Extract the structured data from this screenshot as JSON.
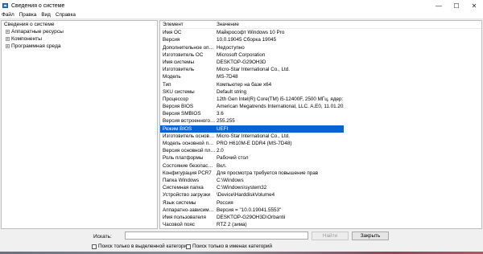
{
  "window": {
    "title": "Сведения о системе",
    "controls": [
      "—",
      "☐",
      "✕"
    ]
  },
  "menu": [
    "Файл",
    "Правка",
    "Вид",
    "Справка"
  ],
  "tree": {
    "root": "Сведения о системе",
    "children": [
      "Аппаратные ресурсы",
      "Компоненты",
      "Программная среда"
    ]
  },
  "table": {
    "headers": [
      "Элемент",
      "Значение"
    ],
    "rows": [
      [
        "Имя ОС",
        "Майкрософт Windows 10 Pro"
      ],
      [
        "Версия",
        "10.0.19045 Сборка 19045"
      ],
      [
        "Дополнительное опис...",
        "Недоступно"
      ],
      [
        "Изготовитель ОС",
        "Microsoft Corporation"
      ],
      [
        "Имя системы",
        "DESKTOP-G29OH3D"
      ],
      [
        "Изготовитель",
        "Micro-Star International Co., Ltd."
      ],
      [
        "Модель",
        "MS-7D48"
      ],
      [
        "Тип",
        "Компьютер на базе x64"
      ],
      [
        "SKU системы",
        "Default string"
      ],
      [
        "Процессор",
        "12th Gen Intel(R) Core(TM) i5-12400F, 2500 МГц, ядер: 6, л..."
      ],
      [
        "Версия BIOS",
        "American Megatrends International, LLC. A.E0, 11.01.2024"
      ],
      [
        "Версия SMBIOS",
        "3.6"
      ],
      [
        "Версия встроенного к...",
        "255.255"
      ],
      [
        "Режим BIOS",
        "UEFI"
      ],
      [
        "Изготовитель основно...",
        "Micro-Star International Co., Ltd."
      ],
      [
        "Модель основной плат...",
        "PRO H610M-E DDR4 (MS-7D48)"
      ],
      [
        "Версия основной плат...",
        "2.0"
      ],
      [
        "Роль платформы",
        "Рабочий стол"
      ],
      [
        "Состояние безопасно...",
        "Вкл."
      ],
      [
        "Конфигурация PCR7",
        "Для просмотра требуется повышение прав"
      ],
      [
        "Папка Windows",
        "C:\\Windows"
      ],
      [
        "Системная папка",
        "C:\\Windows\\system32"
      ],
      [
        "Устройство загрузки",
        "\\Device\\HarddiskVolume4"
      ],
      [
        "Язык системы",
        "Россия"
      ],
      [
        "Аппаратно-зависимы...",
        "Версия = \"10.0.19041.5553\""
      ],
      [
        "Имя пользователя",
        "DESKTOP-G29OH3D\\Orbantii"
      ],
      [
        "Часовой пояс",
        "RTZ 2 (зима)"
      ],
      [
        "Установленная операт...",
        "32,0 ГБ"
      ]
    ],
    "selected_index": 13
  },
  "search": {
    "label": "Искать:",
    "value": "",
    "find_label": "Найти",
    "close_label": "Закрыть",
    "check_selected": "Поиск только в выделенной категории",
    "check_names": "Поиск только в именах категорий"
  },
  "colors": {
    "selection": "#0a63d6",
    "background": "#f0f0f0"
  }
}
